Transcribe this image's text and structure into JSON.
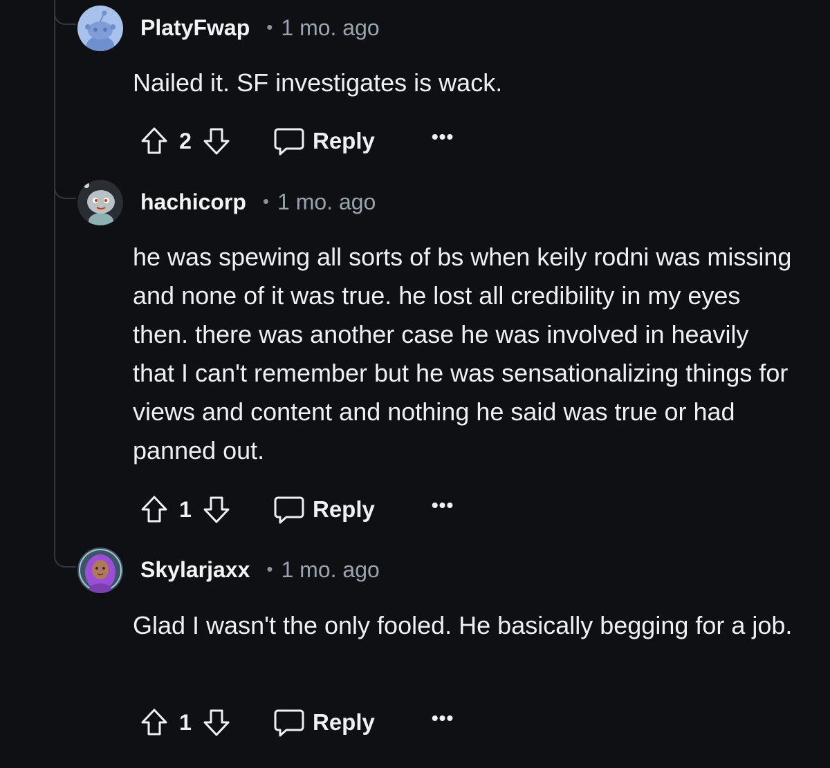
{
  "comments": [
    {
      "username": "PlatyFwap",
      "separator": "•",
      "time": "1 mo. ago",
      "text": "Nailed it. SF investigates is wack.",
      "score": "2",
      "reply_label": "Reply",
      "more_label": "•••",
      "avatar_icon": "reddit-snoo-avatar-blue"
    },
    {
      "username": "hachicorp",
      "separator": "•",
      "time": "1 mo. ago",
      "text": "he was spewing all sorts of bs when keily rodni was missing and none of it was true. he lost all credibility in my eyes then. there was another case he was involved in heavily that I can't remember but he was sensationalizing things for views and content and nothing he said was true or had panned out.",
      "score": "1",
      "reply_label": "Reply",
      "more_label": "•••",
      "avatar_icon": "reddit-snoo-avatar-gray"
    },
    {
      "username": "Skylarjaxx",
      "separator": "•",
      "time": "1 mo. ago",
      "text": "Glad I wasn't the only fooled. He basically begging for a job.",
      "score": "1",
      "reply_label": "Reply",
      "more_label": "•••",
      "avatar_icon": "purple-hair-avatar"
    }
  ],
  "colors": {
    "background": "#0f1013",
    "thread_line": "#33383d",
    "text": "#eef1f3",
    "meta": "#9aa4ad"
  }
}
